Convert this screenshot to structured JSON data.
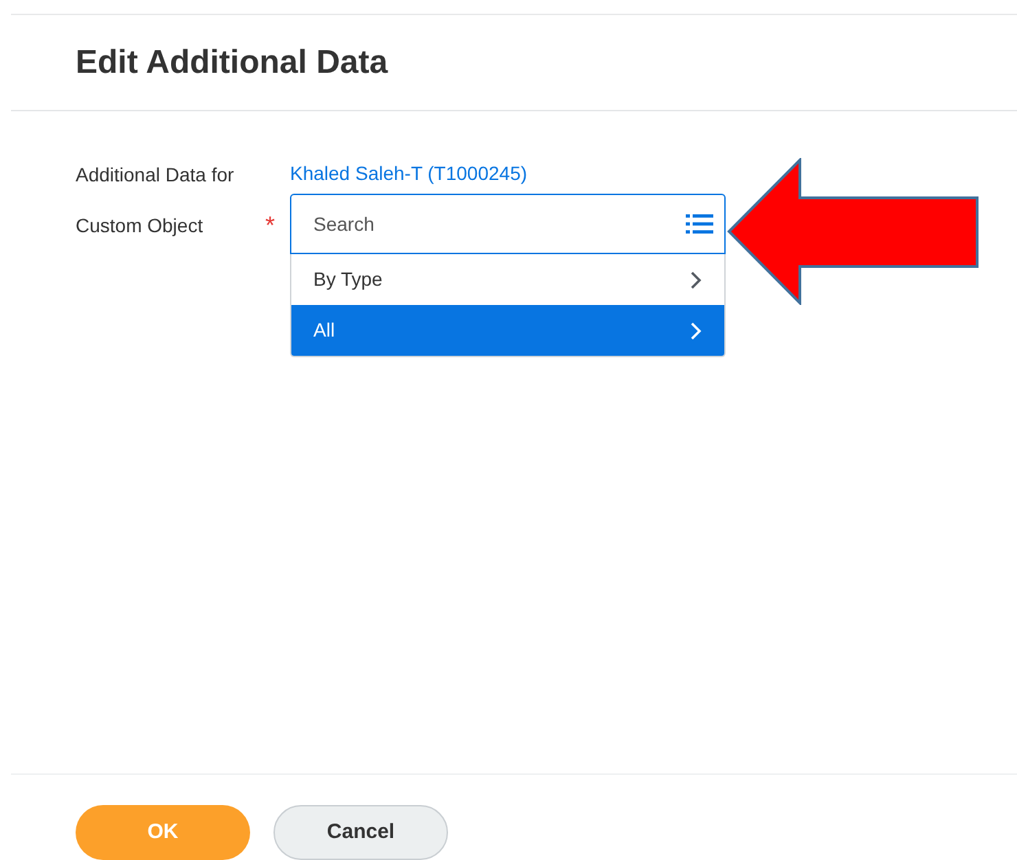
{
  "title": "Edit Additional Data",
  "fields": [
    {
      "label": "Additional Data for",
      "kind": "link",
      "value": "Khaled Saleh-T (T1000245)"
    },
    {
      "label": "Custom Object",
      "kind": "search",
      "required_mark": "*",
      "placeholder": "Search"
    }
  ],
  "dropdown": {
    "items": [
      {
        "label": "By Type",
        "selected": false
      },
      {
        "label": "All",
        "selected": true
      }
    ]
  },
  "buttons": [
    {
      "label": "OK",
      "kind": "primary"
    },
    {
      "label": "Cancel",
      "kind": "secondary"
    }
  ]
}
